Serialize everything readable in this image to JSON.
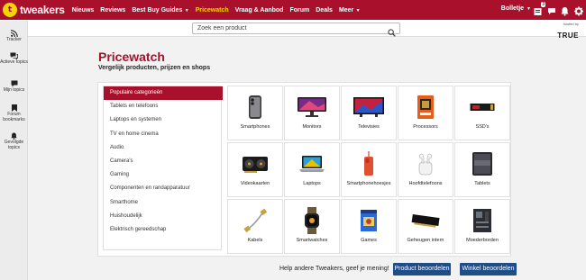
{
  "brand": {
    "name": "tweakers",
    "logo_letter": "t"
  },
  "nav": [
    {
      "label": "Nieuws",
      "dropdown": false,
      "active": false
    },
    {
      "label": "Reviews",
      "dropdown": false,
      "active": false
    },
    {
      "label": "Best Buy Guides",
      "dropdown": true,
      "active": false
    },
    {
      "label": "Pricewatch",
      "dropdown": false,
      "active": true
    },
    {
      "label": "Vraag & Aanbod",
      "dropdown": false,
      "active": false
    },
    {
      "label": "Forum",
      "dropdown": false,
      "active": false
    },
    {
      "label": "Deals",
      "dropdown": false,
      "active": false
    },
    {
      "label": "Meer",
      "dropdown": true,
      "active": false
    }
  ],
  "user": {
    "name": "Bolletje",
    "notification_count": "3"
  },
  "search": {
    "placeholder": "Zoek een product"
  },
  "hosted": {
    "small": "hosted by",
    "brand": "TRUE"
  },
  "sidebar": [
    {
      "label": "Tracker",
      "icon": "rss-icon"
    },
    {
      "label": "Actieve topics",
      "icon": "chat-icon"
    },
    {
      "label": "Mijn topics",
      "icon": "comment-icon"
    },
    {
      "label": "Forum bookmarks",
      "icon": "bookmark-icon"
    },
    {
      "label": "Gevolgde topics",
      "icon": "bell-icon"
    }
  ],
  "page": {
    "title": "Pricewatch",
    "subtitle": "Vergelijk producten, prijzen en shops"
  },
  "categories": [
    "Populaire categorieën",
    "Tablets en telefoons",
    "Laptops en systemen",
    "TV en home cinema",
    "Audio",
    "Camera's",
    "Gaming",
    "Componenten en randapparatuur",
    "Smarthome",
    "Huishoudelijk",
    "Elektrisch gereedschap"
  ],
  "active_category": 0,
  "tiles": [
    {
      "label": "Smartphones",
      "icon": "smartphone-icon"
    },
    {
      "label": "Monitors",
      "icon": "monitor-icon"
    },
    {
      "label": "Televisies",
      "icon": "television-icon"
    },
    {
      "label": "Processors",
      "icon": "processor-icon"
    },
    {
      "label": "SSD's",
      "icon": "ssd-icon"
    },
    {
      "label": "Videokaarten",
      "icon": "videocard-icon"
    },
    {
      "label": "Laptops",
      "icon": "laptop-icon"
    },
    {
      "label": "Smartphonehoesjes",
      "icon": "phonecase-icon"
    },
    {
      "label": "Hoofdtelefoons",
      "icon": "earbuds-icon"
    },
    {
      "label": "Tablets",
      "icon": "tablet-icon"
    },
    {
      "label": "Kabels",
      "icon": "cable-icon"
    },
    {
      "label": "Smartwatches",
      "icon": "smartwatch-icon"
    },
    {
      "label": "Games",
      "icon": "game-box-icon"
    },
    {
      "label": "Geheugen intern",
      "icon": "memory-icon"
    },
    {
      "label": "Moederborden",
      "icon": "motherboard-icon"
    }
  ],
  "footer": {
    "text": "Help andere Tweakers, geef je mening!",
    "product_button": "Product beoordelen",
    "shop_button": "Winkel beoordelen"
  },
  "colors": {
    "brand": "#a8102c",
    "accent": "#ffd200",
    "button": "#1f4d88"
  }
}
